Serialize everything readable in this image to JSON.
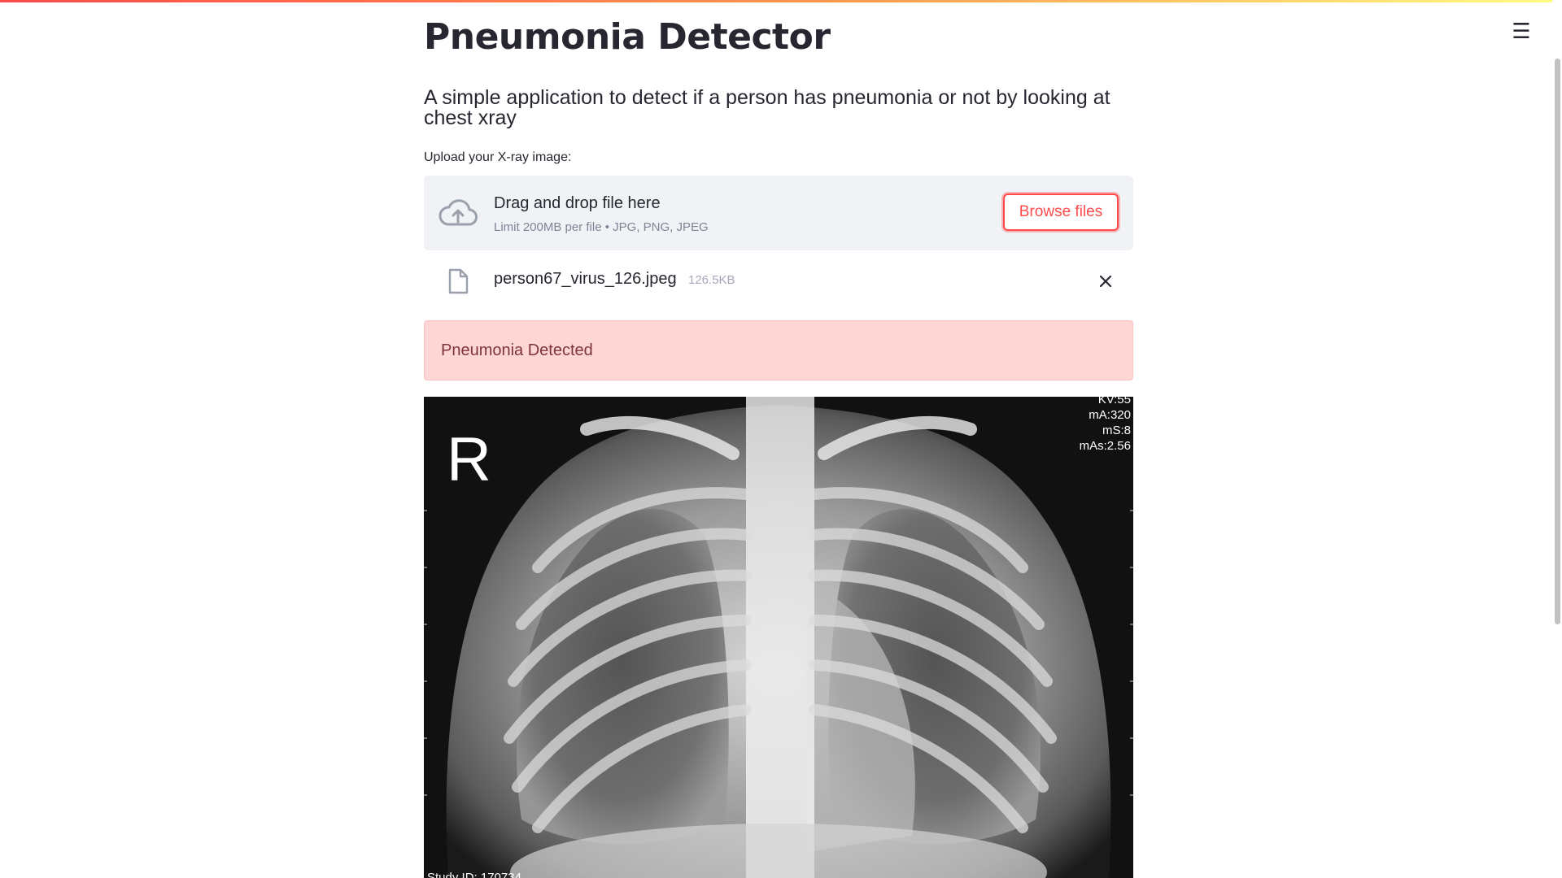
{
  "app": {
    "title": "Pneumonia Detector",
    "subtitle": "A simple application to detect if a person has pneumonia or not by looking at chest xray",
    "accent_color": "#ff4b4b",
    "menu_icon": "hamburger-menu-icon"
  },
  "uploader": {
    "label": "Upload your X-ray image:",
    "drop_text": "Drag and drop file here",
    "limit_text": "Limit 200MB per file • JPG, PNG, JPEG",
    "browse_label": "Browse files",
    "icon": "cloud-upload-icon"
  },
  "uploaded_file": {
    "name": "person67_virus_126.jpeg",
    "size": "126.5KB",
    "icon": "file-icon",
    "remove_icon": "close-icon"
  },
  "result": {
    "text": "Pneumonia Detected",
    "background": "#ffd6d6",
    "text_color": "#7d353b"
  },
  "xray": {
    "side_marker": "R",
    "meta": [
      "KV:55",
      "mA:320",
      "mS:8",
      "mAs:2.56"
    ],
    "footer": "Study ID: 170734"
  }
}
